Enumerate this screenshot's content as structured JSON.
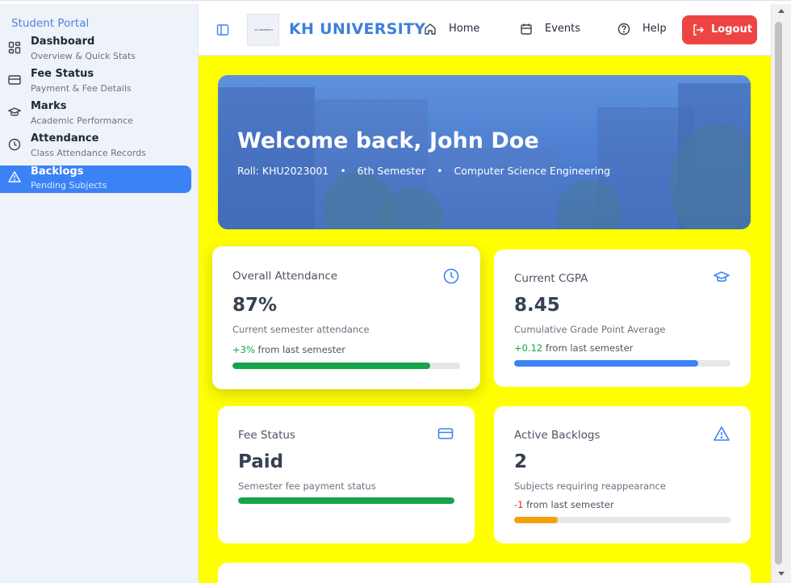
{
  "sidebar": {
    "title": "Student Portal",
    "items": [
      {
        "label": "Dashboard",
        "sub": "Overview & Quick Stats",
        "icon": "dashboard-grid-icon",
        "active": false
      },
      {
        "label": "Fee Status",
        "sub": "Payment & Fee Details",
        "icon": "credit-card-icon",
        "active": false
      },
      {
        "label": "Marks",
        "sub": "Academic Performance",
        "icon": "graduation-cap-icon",
        "active": false
      },
      {
        "label": "Attendance",
        "sub": "Class Attendance Records",
        "icon": "clock-icon",
        "active": false
      },
      {
        "label": "Backlogs",
        "sub": "Pending Subjects",
        "icon": "warning-triangle-icon",
        "active": true
      }
    ]
  },
  "header": {
    "brand": "KH UNIVERSITY",
    "logo_text": "KH UNIVERSITY",
    "nav": [
      {
        "label": "Home",
        "icon": "home-icon"
      },
      {
        "label": "Events",
        "icon": "calendar-icon"
      },
      {
        "label": "Help",
        "icon": "help-circle-icon"
      }
    ],
    "logout_label": "Logout"
  },
  "hero": {
    "title": "Welcome back, John Doe",
    "roll": "Roll: KHU2023001",
    "semester": "6th Semester",
    "program": "Computer Science Engineering",
    "separator": "•"
  },
  "cards": {
    "attendance": {
      "title": "Overall Attendance",
      "value": "87%",
      "desc": "Current semester attendance",
      "delta": "+3%",
      "delta_text": "from last semester",
      "progress": 0.87,
      "color": "#16a34a"
    },
    "cgpa": {
      "title": "Current CGPA",
      "value": "8.45",
      "desc": "Cumulative Grade Point Average",
      "delta": "+0.12",
      "delta_text": "from last semester",
      "progress": 0.85,
      "color": "#3b82f6"
    },
    "fee": {
      "title": "Fee Status",
      "value": "Paid",
      "desc": "Semester fee payment status",
      "progress": 1.0,
      "color": "#16a34a"
    },
    "backlogs": {
      "title": "Active Backlogs",
      "value": "2",
      "desc": "Subjects requiring reappearance",
      "delta": "-1",
      "delta_text": "from last semester",
      "progress": 0.2,
      "color": "#f59e0b"
    }
  },
  "colors": {
    "accent": "#3b82f6",
    "brand": "#3f7fd9",
    "logout": "#ef4444",
    "main_bg": "#ffff00"
  }
}
